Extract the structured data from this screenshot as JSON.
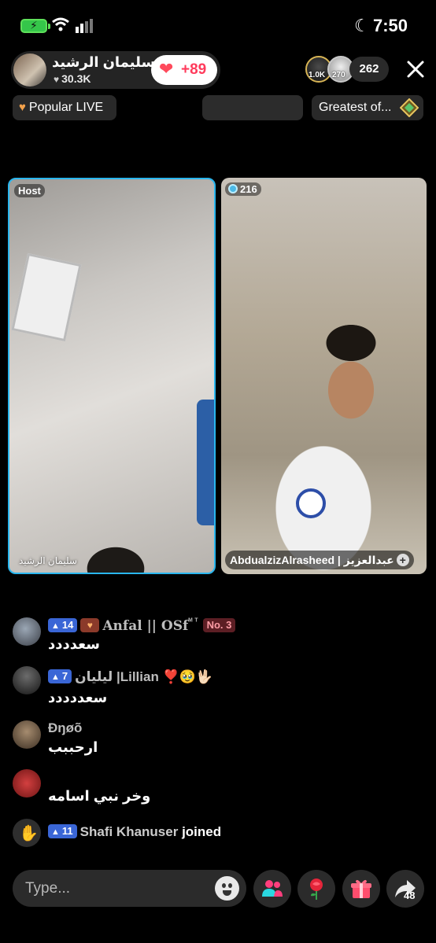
{
  "status_bar": {
    "time": "7:50"
  },
  "host": {
    "name": "سليمان الرشيد",
    "likes": "30.3K",
    "follow_plus": "+89"
  },
  "viewers": {
    "badge1": "1.0K",
    "badge2": "270",
    "count": "262"
  },
  "chips": {
    "popular": "Popular LIVE",
    "greatest": "Greatest of..."
  },
  "panels": {
    "host_tag": "Host",
    "host_label": "سليمان الرشيد",
    "guest_score": "216",
    "guest_label": "AbdualzizAlrasheed | عبدالعزيز"
  },
  "chat": [
    {
      "level": "14",
      "name": "Anfal || OSf",
      "sup": "ᴹ ᵀ",
      "rank": "No. 3",
      "text": "سعدددد"
    },
    {
      "level": "7",
      "name": "ليليان |Lillian ❣️🥹🖖🏻",
      "text": "سعددددد"
    },
    {
      "name": "Đŋøõ",
      "text": "ارحببب"
    },
    {
      "text": "وخر نبي اسامه"
    },
    {
      "level": "11",
      "name": "Shafi Khanuser",
      "action": "joined"
    }
  ],
  "bottom": {
    "input_placeholder": "Type...",
    "share_count": "48"
  },
  "colors": {
    "accent_blue": "#29b6ee",
    "level_badge": "#3a66d6",
    "follow_heart": "#ff4a5c"
  }
}
